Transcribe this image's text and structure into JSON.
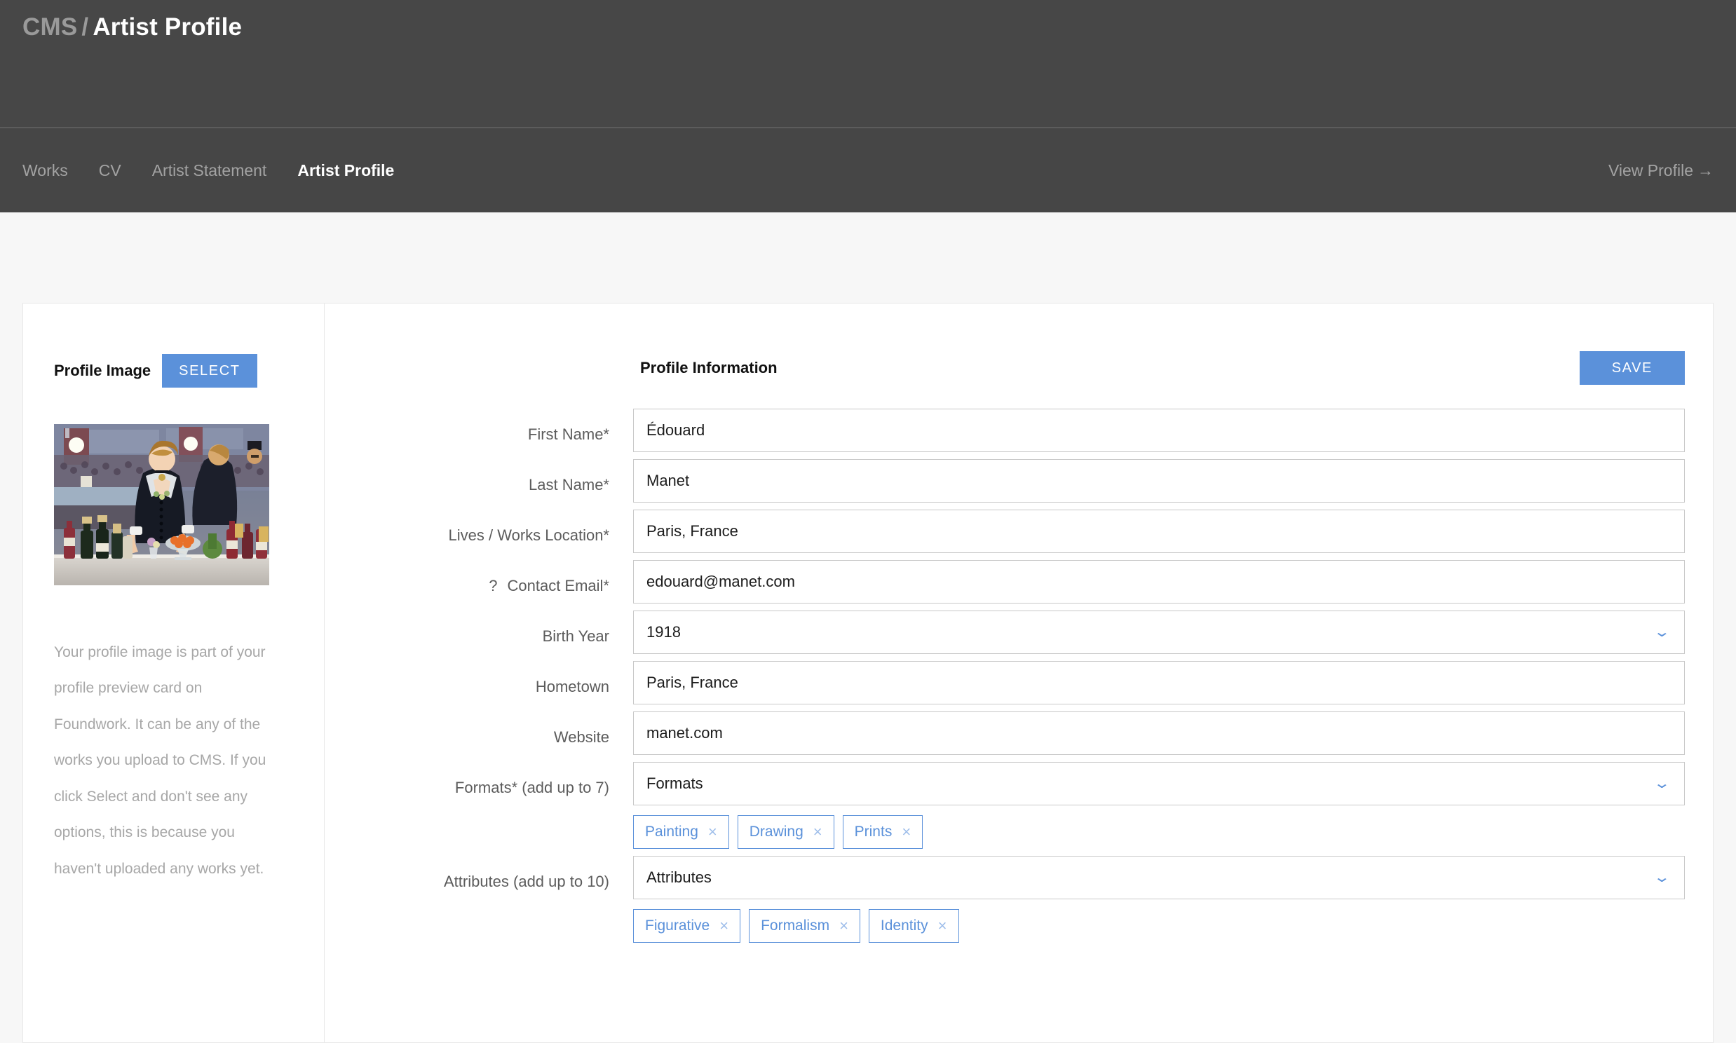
{
  "header": {
    "breadcrumb_root": "CMS",
    "breadcrumb_separator": "/",
    "breadcrumb_current": "Artist Profile"
  },
  "nav": {
    "items": [
      {
        "label": "Works",
        "active": false
      },
      {
        "label": "CV",
        "active": false
      },
      {
        "label": "Artist Statement",
        "active": false
      },
      {
        "label": "Artist Profile",
        "active": true
      }
    ],
    "view_profile_label": "View Profile",
    "view_profile_arrow": "→"
  },
  "profile_image_panel": {
    "title": "Profile Image",
    "select_button": "SELECT",
    "help_text": "Your profile image is part of your profile preview card on Foundwork. It can be any of the works you upload to CMS. If you click Select and don't see any options, this is because you haven't uploaded any works yet."
  },
  "profile_information": {
    "title": "Profile Information",
    "save_button": "SAVE",
    "fields": {
      "first_name": {
        "label": "First Name*",
        "value": "Édouard",
        "placeholder": ""
      },
      "last_name": {
        "label": "Last Name*",
        "value": "Manet",
        "placeholder": ""
      },
      "location": {
        "label": "Lives / Works Location*",
        "value": "Paris, France",
        "placeholder": ""
      },
      "contact_email": {
        "label": "Contact Email*",
        "help_marker": "?",
        "value": "edouard@manet.com",
        "placeholder": ""
      },
      "birth_year": {
        "label": "Birth Year",
        "value": "1918"
      },
      "hometown": {
        "label": "Hometown",
        "value": "Paris, France",
        "placeholder": ""
      },
      "website": {
        "label": "Website",
        "value": "manet.com",
        "placeholder": ""
      },
      "formats": {
        "label": "Formats* (add up to 7)",
        "select_value": "Formats",
        "tags": [
          "Painting",
          "Drawing",
          "Prints"
        ]
      },
      "attributes": {
        "label": "Attributes (add up to 10)",
        "select_value": "Attributes",
        "tags": [
          "Figurative",
          "Formalism",
          "Identity"
        ]
      }
    },
    "tag_remove_glyph": "×",
    "chevron_glyph": "⌄"
  },
  "colors": {
    "accent": "#5b91da",
    "header_bg": "#474747",
    "nav_bg": "#464646",
    "page_bg": "#f7f7f7",
    "card_bg": "#ffffff",
    "label_text": "#5c5c5c",
    "help_text": "#a7a7a7"
  }
}
